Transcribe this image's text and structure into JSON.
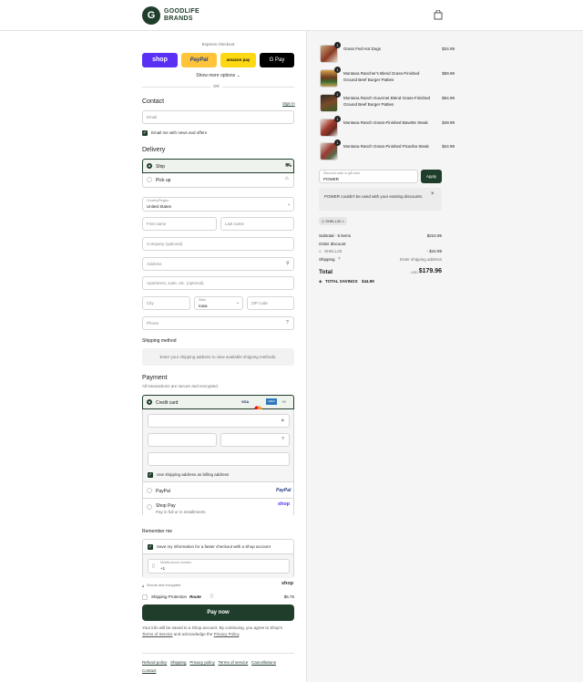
{
  "header": {
    "logo_glyph": "G",
    "brand_line1": "GOODLIFE",
    "brand_line2": "BRANDS"
  },
  "express": {
    "title": "Express checkout",
    "shop": "shop",
    "paypal": "PayPal",
    "amazon": "amazon pay",
    "gpay": "G Pay",
    "more": "Show more options",
    "or": "OR"
  },
  "contact": {
    "title": "Contact",
    "sign_in": "Sign in",
    "email_placeholder": "Email",
    "news_label": "Email me with news and offers"
  },
  "delivery": {
    "title": "Delivery",
    "ship": "Ship",
    "pickup": "Pick up",
    "country_label": "Country/Region",
    "country_value": "United States",
    "first": "First name",
    "last": "Last name",
    "company": "Company (optional)",
    "address": "Address",
    "apt": "Apartment, suite, etc. (optional)",
    "city": "City",
    "state_label": "State",
    "state_value": "Iowa",
    "zip": "ZIP code",
    "phone": "Phone"
  },
  "shipping": {
    "title": "Shipping method",
    "note": "Enter your shipping address to view available shipping methods."
  },
  "payment": {
    "title": "Payment",
    "subtitle": "All transactions are secure and encrypted.",
    "credit": "Credit card",
    "visa": "VISA",
    "amex": "AMEX",
    "more": "+5",
    "billing": "Use shipping address as billing address",
    "paypal": "PayPal",
    "paypal_logo": "PayPal",
    "shoppay": "Shop Pay",
    "shoppay_sub": "Pay in full or in installments",
    "shoppay_logo": "shop"
  },
  "remember": {
    "title": "Remember me",
    "save": "Save my information for a faster checkout with a Shop account",
    "mobile_label": "Mobile phone number",
    "mobile_value": "+1",
    "secure": "Secure and encrypted",
    "shop_logo": "shop"
  },
  "protection": {
    "label": "Shipping Protection",
    "route": "Route",
    "price": "$6.75"
  },
  "pay_now": "Pay now",
  "terms": {
    "text1": "Your info will be saved to a Shop account. By continuing, you agree to Shop's",
    "tos": "Terms of Service",
    "text2": "and acknowledge the",
    "privacy": "Privacy Policy",
    "end": "."
  },
  "footer": [
    "Refund policy",
    "Shipping",
    "Privacy policy",
    "Terms of service",
    "Cancellations",
    "Contact"
  ],
  "cart": {
    "items": [
      {
        "name": "Grass Fed Hot Dogs",
        "price": "$24.99",
        "qty": "1"
      },
      {
        "name": "Montana Rancher's Blend Grass-Finished Ground Beef Burger Patties",
        "price": "$59.99",
        "qty": "1"
      },
      {
        "name": "Montana Ranch Gourmet Blend Grass-Finished Ground Beef Burger Patties",
        "price": "$64.99",
        "qty": "1"
      },
      {
        "name": "Montana Ranch Grass-Finished Bavette Steak",
        "price": "$49.99",
        "qty": "1"
      },
      {
        "name": "Montana Ranch Grass-Finished Picanha Steak",
        "price": "$24.99",
        "qty": "1"
      }
    ],
    "discount_label": "Discount code or gift card",
    "discount_value": "POWER",
    "apply": "Apply",
    "error": "POWER couldn't be used with your existing discounts.",
    "tag": "SHELL20",
    "subtotal_label": "Subtotal · 5 items",
    "subtotal": "$224.95",
    "order_discount": "Order discount",
    "code": "SHELL20",
    "discount_amount": "- $44.99",
    "shipping_label": "Shipping",
    "shipping_value": "Enter shipping address",
    "total_label": "Total",
    "currency": "USD",
    "total": "$179.96",
    "savings_label": "TOTAL SAVINGS",
    "savings": "$44.99"
  }
}
